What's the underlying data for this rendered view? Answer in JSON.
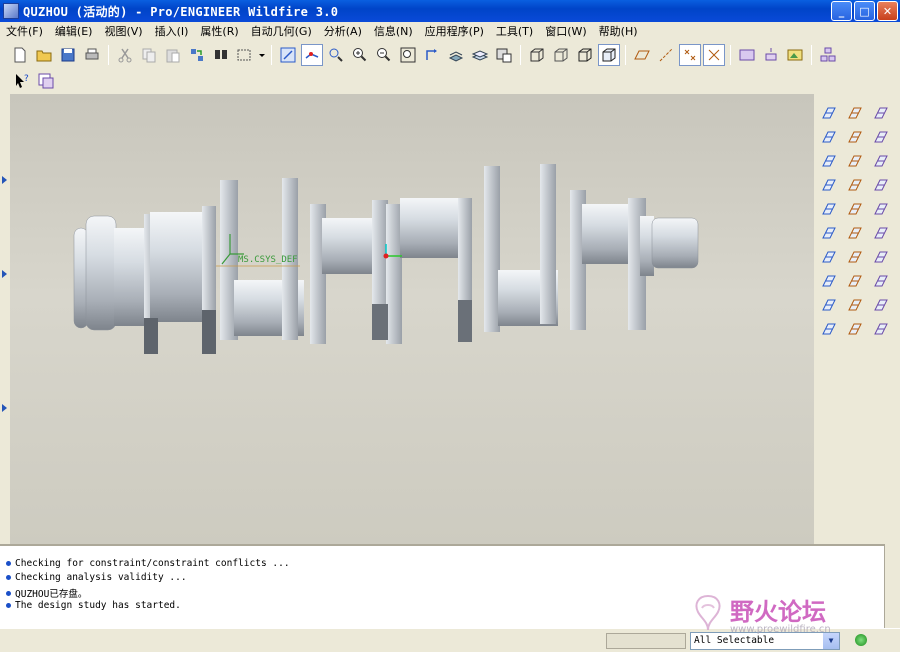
{
  "window": {
    "title": "QUZHOU (活动的) - Pro/ENGINEER Wildfire 3.0",
    "buttons": [
      "minimize",
      "maximize",
      "close"
    ]
  },
  "menu": [
    {
      "label": "文件(F)"
    },
    {
      "label": "编辑(E)"
    },
    {
      "label": "视图(V)"
    },
    {
      "label": "插入(I)"
    },
    {
      "label": "属性(R)"
    },
    {
      "label": "自动几何(G)"
    },
    {
      "label": "分析(A)"
    },
    {
      "label": "信息(N)"
    },
    {
      "label": "应用程序(P)"
    },
    {
      "label": "工具(T)"
    },
    {
      "label": "窗口(W)"
    },
    {
      "label": "帮助(H)"
    }
  ],
  "toolbar": {
    "file_icons": [
      "new-file-icon",
      "open-folder-icon",
      "save-icon",
      "print-icon"
    ],
    "edit_icons": [
      "cut-icon",
      "copy-icon",
      "paste-icon",
      "regenerate-icon",
      "find-icon",
      "selection-box-icon"
    ],
    "view_icons": [
      "repaint-icon",
      "spin-center-icon",
      "orient-mode-icon",
      "zoom-in-icon",
      "zoom-out-icon",
      "refit-icon",
      "reorient-icon",
      "saved-views-icon",
      "layers-icon",
      "view-manager-icon"
    ],
    "display_icons": [
      "wireframe-icon",
      "hidden-line-icon",
      "no-hidden-icon",
      "shading-icon"
    ],
    "datum_icons": [
      "datum-planes-icon",
      "datum-axes-icon",
      "datum-points-icon",
      "datum-csys-icon"
    ],
    "misc_icons": [
      "model-tree-icon",
      "bom-icon",
      "appearance-icon",
      "assembly-icon"
    ],
    "row2_icons": [
      "context-help-icon",
      "sketch-icon"
    ]
  },
  "model": {
    "csys_label": "MS.CSYS_DEF"
  },
  "right_toolbar": {
    "icons": [
      "datum-plane-icon",
      "analysis-feature-icon",
      "sketch-curve-icon",
      "datum-axis-icon",
      "cosmetic-icon",
      "datum-plane-offset-icon",
      "datum-point-icon",
      "round-icon",
      "datum-curve-icon",
      "csys-icon",
      "mirror-icon",
      "sweep-curve-icon",
      "extrude-icon",
      "shell-icon",
      "cross-icon",
      "revolve-icon",
      "pattern-icon",
      "hole-icon",
      "sweep-icon",
      "draft-icon",
      "chamfer-icon",
      "blend-icon",
      "rib-icon",
      "helix-icon",
      "warp-icon",
      "flexible-icon",
      "copy-icon",
      "surface-icon",
      "merge-icon",
      "trim-icon"
    ]
  },
  "messages": [
    "Checking for constraint/constraint conflicts ...",
    "Checking analysis validity ...",
    "QUZHOU已存盘。",
    "The design study has started."
  ],
  "status": {
    "filter_value": "All Selectable"
  },
  "watermark": {
    "text": "野火论坛",
    "url": "www.proewildfire.cn"
  }
}
